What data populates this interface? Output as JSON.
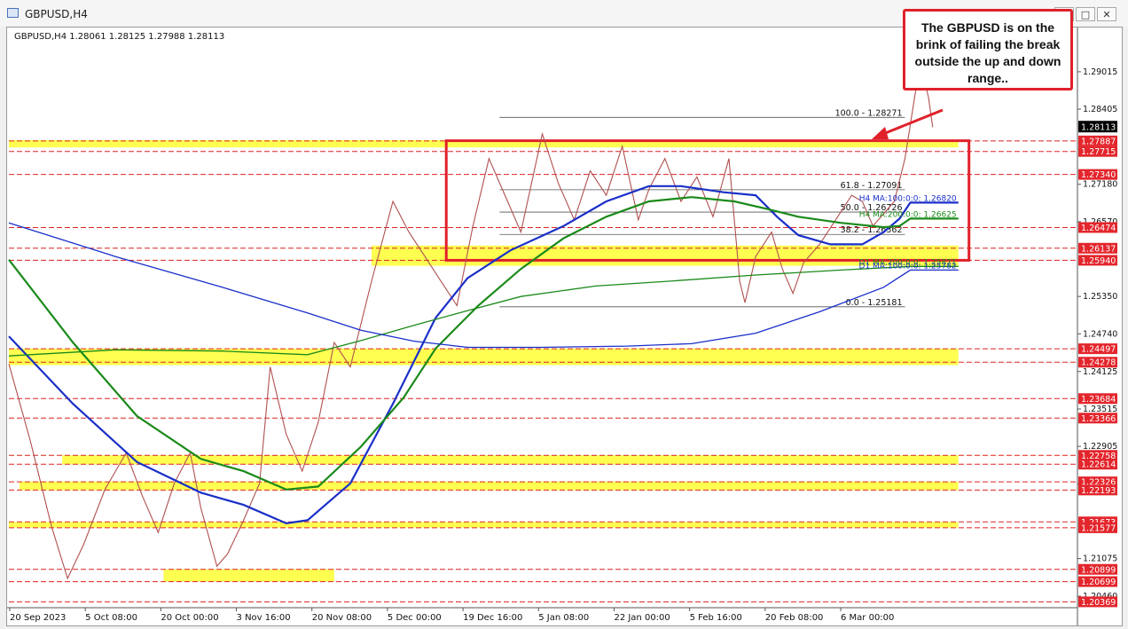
{
  "window": {
    "title": "GBPUSD,H4",
    "buttons": [
      "_",
      "□",
      "✕"
    ]
  },
  "chart_data": {
    "type": "candlestick",
    "info_line": "GBPUSD,H4  1.28061 1.28125 1.27988 1.28113",
    "ylim": [
      1.2036,
      1.2965
    ],
    "y_ticks": [
      "1.29015",
      "1.28405",
      "1.27180",
      "1.26570",
      "1.25350",
      "1.24740",
      "1.24125",
      "1.23515",
      "1.22905",
      "1.22295",
      "1.21075",
      "1.20460"
    ],
    "x_ticks": [
      {
        "label": "20 Sep 2023",
        "x": 0
      },
      {
        "label": "5 Oct 08:00",
        "x": 1
      },
      {
        "label": "20 Oct 00:00",
        "x": 2
      },
      {
        "label": "3 Nov 16:00",
        "x": 3
      },
      {
        "label": "20 Nov 08:00",
        "x": 4
      },
      {
        "label": "5 Dec 00:00",
        "x": 5
      },
      {
        "label": "19 Dec 16:00",
        "x": 6
      },
      {
        "label": "5 Jan 08:00",
        "x": 7
      },
      {
        "label": "22 Jan 00:00",
        "x": 8
      },
      {
        "label": "5 Feb 16:00",
        "x": 9
      },
      {
        "label": "20 Feb 08:00",
        "x": 10
      },
      {
        "label": "6 Mar 00:00",
        "x": 11
      }
    ],
    "current_price": "1.28113",
    "level_labels": [
      {
        "price": 1.27887,
        "label": "1.27887"
      },
      {
        "price": 1.27715,
        "label": "1.27715"
      },
      {
        "price": 1.2734,
        "label": "1.27340"
      },
      {
        "price": 1.26474,
        "label": "1.26474"
      },
      {
        "price": 1.26137,
        "label": "1.26137"
      },
      {
        "price": 1.2594,
        "label": "1.25940"
      },
      {
        "price": 1.24497,
        "label": "1.24497"
      },
      {
        "price": 1.24278,
        "label": "1.24278"
      },
      {
        "price": 1.23684,
        "label": "1.23684"
      },
      {
        "price": 1.23366,
        "label": "1.23366"
      },
      {
        "price": 1.22758,
        "label": "1.22758"
      },
      {
        "price": 1.22614,
        "label": "1.22614"
      },
      {
        "price": 1.22326,
        "label": "1.22326"
      },
      {
        "price": 1.22193,
        "label": "1.22193"
      },
      {
        "price": 1.21673,
        "label": "1.21673"
      },
      {
        "price": 1.21577,
        "label": "1.21577"
      },
      {
        "price": 1.20899,
        "label": "1.20899"
      },
      {
        "price": 1.20699,
        "label": "1.20699"
      },
      {
        "price": 1.20369,
        "label": "1.20369"
      }
    ],
    "fib_levels": [
      {
        "price": 1.28271,
        "label": "100.0 - 1.28271"
      },
      {
        "price": 1.27091,
        "label": "61.8 - 1.27091"
      },
      {
        "price": 1.26726,
        "label": "50.0 - 1.26726"
      },
      {
        "price": 1.26362,
        "label": "38.2 - 1.26362"
      },
      {
        "price": 1.25181,
        "label": "0.0 - 1.25181"
      }
    ],
    "ma_labels": [
      {
        "price": 1.2688,
        "label": "H4 MA:100:0:0: 1.26820",
        "color": "#1a2fc8"
      },
      {
        "price": 1.2662,
        "label": "H4 MA:200:0:0: 1.26625",
        "color": "#1a8a1a"
      },
      {
        "price": 1.2584,
        "label": "D1 MA:200:0:0: 1.25871",
        "color": "#1a8a1a"
      },
      {
        "price": 1.2578,
        "label": "D1 MA:100:0:0: 1.25782",
        "color": "#1a2fc8"
      }
    ],
    "series": [
      {
        "name": "H4 MA 100",
        "color": "#1a2fc8",
        "width": 2.2,
        "points": [
          [
            0,
            1.247
          ],
          [
            0.06,
            1.236
          ],
          [
            0.12,
            1.2265
          ],
          [
            0.18,
            1.2215
          ],
          [
            0.22,
            1.2195
          ],
          [
            0.26,
            1.2165
          ],
          [
            0.28,
            1.217
          ],
          [
            0.32,
            1.223
          ],
          [
            0.36,
            1.236
          ],
          [
            0.4,
            1.25
          ],
          [
            0.43,
            1.2565
          ],
          [
            0.47,
            1.261
          ],
          [
            0.52,
            1.265
          ],
          [
            0.56,
            1.269
          ],
          [
            0.6,
            1.2715
          ],
          [
            0.63,
            1.2715
          ],
          [
            0.67,
            1.2705
          ],
          [
            0.7,
            1.27
          ],
          [
            0.72,
            1.2665
          ],
          [
            0.74,
            1.2635
          ],
          [
            0.77,
            1.262
          ],
          [
            0.8,
            1.262
          ],
          [
            0.82,
            1.264
          ],
          [
            0.835,
            1.2662
          ],
          [
            0.845,
            1.2688
          ],
          [
            0.89,
            1.2688
          ]
        ]
      },
      {
        "name": "H4 MA 200",
        "color": "#1a8a1a",
        "width": 2.2,
        "points": [
          [
            0,
            1.2595
          ],
          [
            0.06,
            1.246
          ],
          [
            0.12,
            1.234
          ],
          [
            0.18,
            1.227
          ],
          [
            0.22,
            1.225
          ],
          [
            0.26,
            1.222
          ],
          [
            0.29,
            1.2225
          ],
          [
            0.33,
            1.229
          ],
          [
            0.37,
            1.237
          ],
          [
            0.4,
            1.245
          ],
          [
            0.44,
            1.252
          ],
          [
            0.48,
            1.258
          ],
          [
            0.52,
            1.263
          ],
          [
            0.56,
            1.2665
          ],
          [
            0.6,
            1.269
          ],
          [
            0.64,
            1.2697
          ],
          [
            0.68,
            1.269
          ],
          [
            0.71,
            1.2678
          ],
          [
            0.74,
            1.2665
          ],
          [
            0.78,
            1.2655
          ],
          [
            0.82,
            1.2648
          ],
          [
            0.835,
            1.265
          ],
          [
            0.845,
            1.2662
          ],
          [
            0.89,
            1.2662
          ]
        ]
      },
      {
        "name": "D1 MA 200",
        "color": "#1a8a1a",
        "width": 1.3,
        "points": [
          [
            0,
            1.2438
          ],
          [
            0.1,
            1.2448
          ],
          [
            0.2,
            1.2446
          ],
          [
            0.28,
            1.244
          ],
          [
            0.33,
            1.2463
          ],
          [
            0.38,
            1.2488
          ],
          [
            0.43,
            1.2512
          ],
          [
            0.48,
            1.2535
          ],
          [
            0.55,
            1.2552
          ],
          [
            0.62,
            1.256
          ],
          [
            0.7,
            1.257
          ],
          [
            0.78,
            1.2578
          ],
          [
            0.845,
            1.2584
          ],
          [
            0.89,
            1.2584
          ]
        ]
      },
      {
        "name": "D1 MA 100",
        "color": "#1a2fc8",
        "width": 1.3,
        "points": [
          [
            0,
            1.2655
          ],
          [
            0.1,
            1.26
          ],
          [
            0.2,
            1.255
          ],
          [
            0.28,
            1.2508
          ],
          [
            0.33,
            1.248
          ],
          [
            0.38,
            1.2462
          ],
          [
            0.43,
            1.2452
          ],
          [
            0.5,
            1.2452
          ],
          [
            0.58,
            1.2454
          ],
          [
            0.64,
            1.2458
          ],
          [
            0.7,
            1.2475
          ],
          [
            0.76,
            1.251
          ],
          [
            0.82,
            1.255
          ],
          [
            0.845,
            1.2578
          ],
          [
            0.89,
            1.2578
          ]
        ]
      }
    ],
    "price_path": [
      [
        0,
        1.2425
      ],
      [
        0.02,
        1.23
      ],
      [
        0.04,
        1.216
      ],
      [
        0.055,
        1.2075
      ],
      [
        0.07,
        1.213
      ],
      [
        0.09,
        1.222
      ],
      [
        0.11,
        1.228
      ],
      [
        0.125,
        1.221
      ],
      [
        0.14,
        1.215
      ],
      [
        0.155,
        1.223
      ],
      [
        0.17,
        1.228
      ],
      [
        0.18,
        1.219
      ],
      [
        0.195,
        1.2095
      ],
      [
        0.205,
        1.2115
      ],
      [
        0.22,
        1.217
      ],
      [
        0.235,
        1.223
      ],
      [
        0.245,
        1.242
      ],
      [
        0.26,
        1.231
      ],
      [
        0.275,
        1.225
      ],
      [
        0.29,
        1.233
      ],
      [
        0.305,
        1.246
      ],
      [
        0.32,
        1.242
      ],
      [
        0.34,
        1.256
      ],
      [
        0.36,
        1.269
      ],
      [
        0.375,
        1.264
      ],
      [
        0.39,
        1.26
      ],
      [
        0.405,
        1.256
      ],
      [
        0.42,
        1.252
      ],
      [
        0.435,
        1.265
      ],
      [
        0.45,
        1.276
      ],
      [
        0.465,
        1.27
      ],
      [
        0.48,
        1.264
      ],
      [
        0.5,
        1.28
      ],
      [
        0.515,
        1.272
      ],
      [
        0.53,
        1.266
      ],
      [
        0.545,
        1.274
      ],
      [
        0.56,
        1.27
      ],
      [
        0.575,
        1.278
      ],
      [
        0.59,
        1.266
      ],
      [
        0.6,
        1.271
      ],
      [
        0.615,
        1.276
      ],
      [
        0.63,
        1.269
      ],
      [
        0.645,
        1.273
      ],
      [
        0.66,
        1.2665
      ],
      [
        0.675,
        1.276
      ],
      [
        0.685,
        1.256
      ],
      [
        0.69,
        1.2525
      ],
      [
        0.7,
        1.26
      ],
      [
        0.715,
        1.264
      ],
      [
        0.725,
        1.258
      ],
      [
        0.735,
        1.254
      ],
      [
        0.745,
        1.259
      ],
      [
        0.76,
        1.262
      ],
      [
        0.775,
        1.266
      ],
      [
        0.79,
        1.27
      ],
      [
        0.8,
        1.269
      ],
      [
        0.81,
        1.265
      ],
      [
        0.82,
        1.267
      ],
      [
        0.83,
        1.269
      ],
      [
        0.84,
        1.276
      ],
      [
        0.85,
        1.287
      ],
      [
        0.857,
        1.2895
      ],
      [
        0.862,
        1.286
      ],
      [
        0.866,
        1.2811
      ]
    ],
    "zones": [
      {
        "from": 1.2778,
        "to": 1.279,
        "x0": 0,
        "x1": 0.89
      },
      {
        "from": 1.2585,
        "to": 1.2618,
        "x0": 0.34,
        "x1": 0.89
      },
      {
        "from": 1.2423,
        "to": 1.245,
        "x0": 0,
        "x1": 0.89
      },
      {
        "from": 1.2261,
        "to": 1.2276,
        "x0": 0.05,
        "x1": 0.89
      },
      {
        "from": 1.2219,
        "to": 1.2233,
        "x0": 0.01,
        "x1": 0.89
      },
      {
        "from": 1.2158,
        "to": 1.2167,
        "x0": 0,
        "x1": 0.89
      },
      {
        "from": 1.207,
        "to": 1.209,
        "x0": 0.145,
        "x1": 0.305
      }
    ],
    "range_box": {
      "x0": 0.41,
      "x1": 0.9,
      "top": 1.2789,
      "bottom": 1.2594
    },
    "annotation": {
      "text": "The GBPUSD is on the brink of failing the break outside the up and down range..",
      "lines": [
        "The GBPUSD is on the",
        "brink of failing the break",
        "outside the up and down",
        "range.."
      ]
    }
  }
}
